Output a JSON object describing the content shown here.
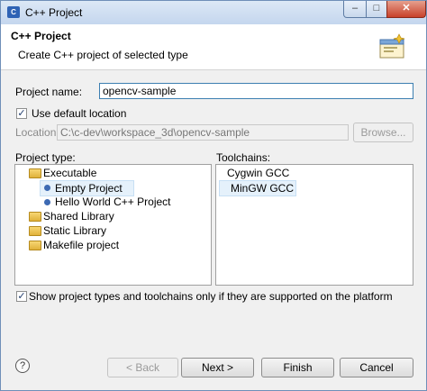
{
  "window": {
    "title": "C++ Project",
    "controls": {
      "minimize": "–",
      "maximize": "□",
      "close": "✕"
    }
  },
  "header": {
    "title": "C++ Project",
    "description": "Create C++ project of selected type"
  },
  "project_name": {
    "label": "Project name:",
    "value": "opencv-sample"
  },
  "default_location": {
    "label": "Use default location",
    "checked": true
  },
  "location": {
    "label": "Location:",
    "value": "C:\\c-dev\\workspace_3d\\opencv-sample",
    "browse_label": "Browse..."
  },
  "project_type": {
    "label": "Project type:",
    "items": [
      {
        "label": "Executable",
        "kind": "folder",
        "level": 0
      },
      {
        "label": "Empty Project",
        "kind": "item",
        "level": 1,
        "selected": true
      },
      {
        "label": "Hello World C++ Project",
        "kind": "item",
        "level": 1
      },
      {
        "label": "Shared Library",
        "kind": "folder",
        "level": 0
      },
      {
        "label": "Static Library",
        "kind": "folder",
        "level": 0
      },
      {
        "label": "Makefile project",
        "kind": "folder",
        "level": 0
      }
    ]
  },
  "toolchains": {
    "label": "Toolchains:",
    "items": [
      {
        "label": "Cygwin GCC",
        "selected": false
      },
      {
        "label": "MinGW GCC",
        "selected": true
      }
    ]
  },
  "show_supported": {
    "label": "Show project types and toolchains only if they are supported on the platform",
    "checked": true
  },
  "buttons": {
    "help": "?",
    "back": "< Back",
    "next": "Next >",
    "finish": "Finish",
    "cancel": "Cancel"
  },
  "colors": {
    "accent": "#3c7fb1",
    "folder": "#e8c04e",
    "bullet": "#3d6ab3"
  }
}
